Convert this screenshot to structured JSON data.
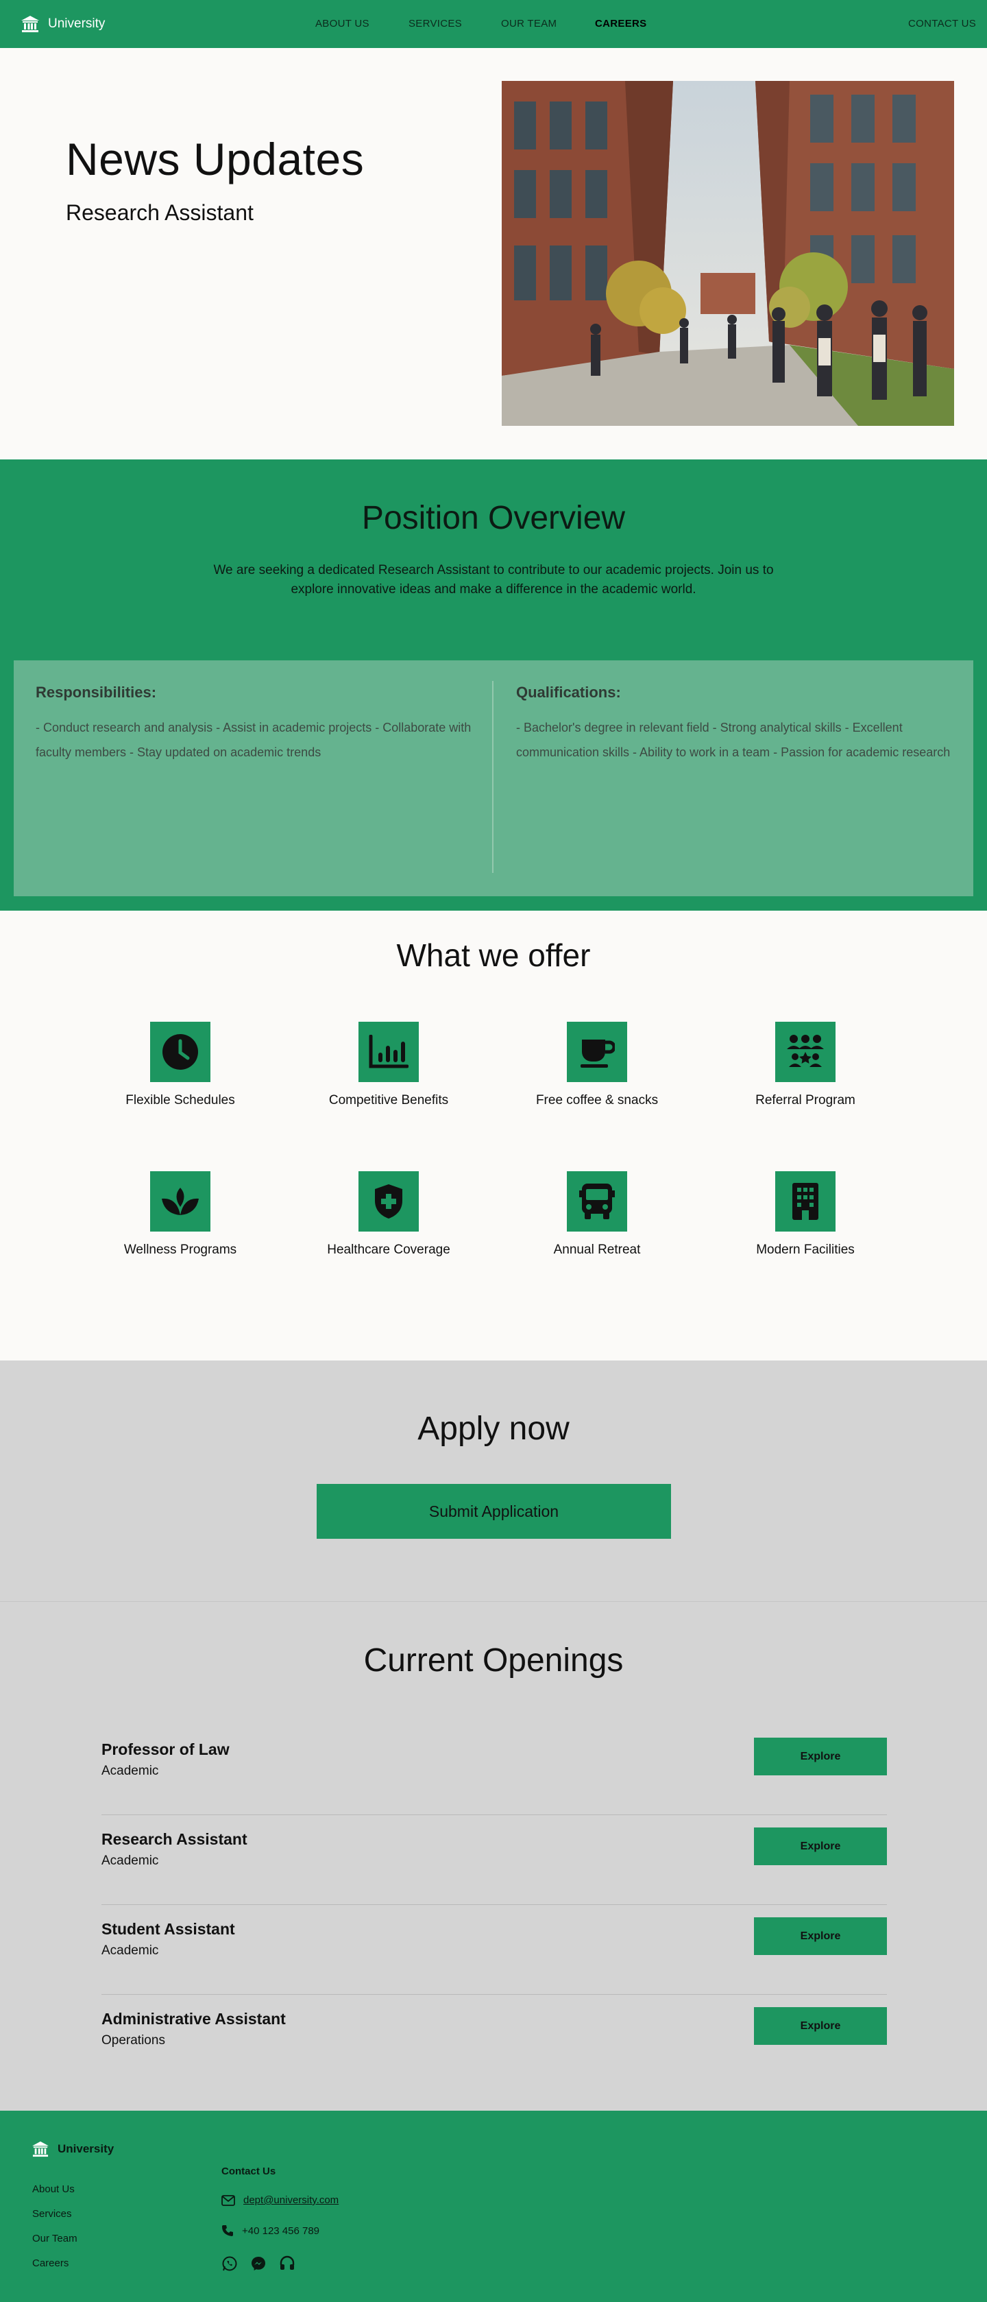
{
  "nav": {
    "brand": "University",
    "links": [
      "ABOUT US",
      "SERVICES",
      "OUR TEAM",
      "CAREERS"
    ],
    "active": "CAREERS",
    "contact": "CONTACT US"
  },
  "hero": {
    "title": "News Updates",
    "subtitle": "Research Assistant"
  },
  "overview": {
    "title": "Position Overview",
    "intro": "We are seeking a dedicated Research Assistant to contribute to our academic projects. Join us to explore innovative ideas and make a difference in the academic world.",
    "responsibilities": {
      "heading": "Responsibilities:",
      "text": "- Conduct research and analysis - Assist in academic projects - Collaborate with faculty members - Stay updated on academic trends"
    },
    "qualifications": {
      "heading": "Qualifications:",
      "text": "- Bachelor's degree in relevant field - Strong analytical skills - Excellent communication skills - Ability to work in a team - Passion for academic research"
    }
  },
  "offer": {
    "title": "What we offer",
    "perks": [
      {
        "label": "Flexible Schedules",
        "icon": "clock-icon"
      },
      {
        "label": "Competitive Benefits",
        "icon": "bar-chart-icon"
      },
      {
        "label": "Free coffee & snacks",
        "icon": "coffee-cup-icon"
      },
      {
        "label": "Referral Program",
        "icon": "group-icon"
      },
      {
        "label": "Wellness Programs",
        "icon": "spa-icon"
      },
      {
        "label": "Healthcare Coverage",
        "icon": "health-shield-icon"
      },
      {
        "label": "Annual Retreat",
        "icon": "bus-icon"
      },
      {
        "label": "Modern Facilities",
        "icon": "building-icon"
      }
    ]
  },
  "apply": {
    "title": "Apply now",
    "button": "Submit Application"
  },
  "openings": {
    "title": "Current Openings",
    "jobs": [
      {
        "title": "Professor of Law",
        "category": "Academic",
        "button": "Explore"
      },
      {
        "title": "Research Assistant",
        "category": "Academic",
        "button": "Explore"
      },
      {
        "title": "Student Assistant",
        "category": "Academic",
        "button": "Explore"
      },
      {
        "title": "Administrative Assistant",
        "category": "Operations",
        "button": "Explore"
      }
    ]
  },
  "footer": {
    "brand": "University",
    "links": [
      "About Us",
      "Services",
      "Our Team",
      "Careers"
    ],
    "contact_title": "Contact Us",
    "email": "dept@university.com",
    "phone": "+40 123 456 789",
    "socials": [
      "whatsapp-icon",
      "messenger-icon",
      "headset-icon"
    ]
  },
  "colors": {
    "brand_green": "#1d9660",
    "panel_green": "#65b38f",
    "gray_section": "#d4d4d4",
    "page_bg": "#fbfaf8"
  }
}
